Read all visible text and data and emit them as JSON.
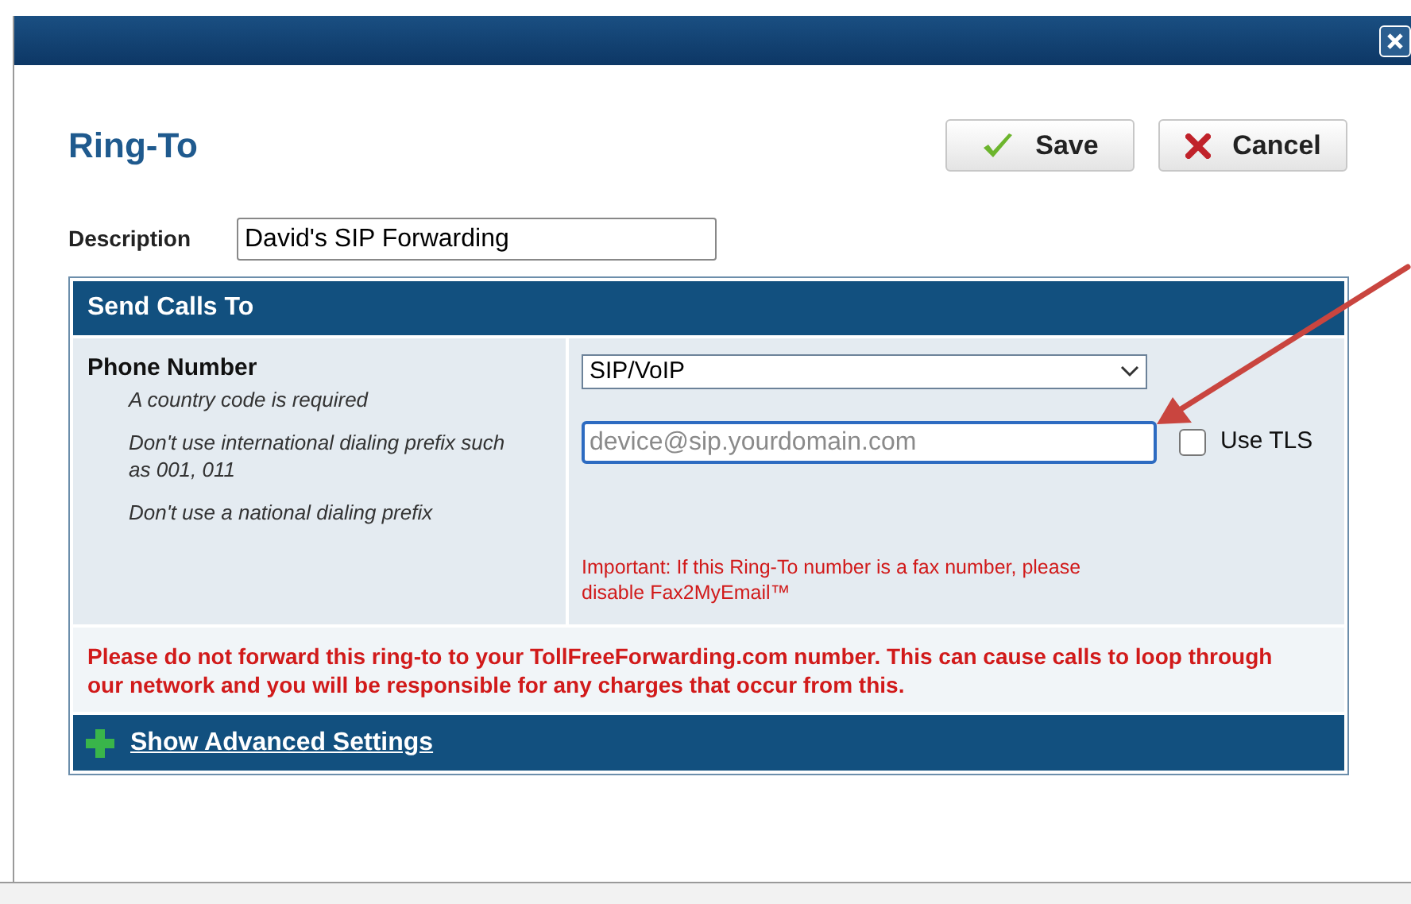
{
  "dialog": {
    "title": "Ring-To",
    "buttons": [
      {
        "kind": "save",
        "label": "Save"
      },
      {
        "kind": "cancel",
        "label": "Cancel"
      }
    ]
  },
  "description": {
    "label": "Description",
    "value": "David's SIP Forwarding"
  },
  "send_calls_to": {
    "heading": "Send Calls To",
    "phone_label": "Phone Number",
    "hints": [
      "A country code is required",
      "Don't use international dialing prefix such as 001, 011",
      "Don't use a national dialing prefix"
    ],
    "type_select": {
      "value": "SIP/VoIP"
    },
    "address_field": {
      "placeholder": "device@sip.yourdomain.com"
    },
    "use_tls": {
      "label": "Use TLS",
      "checked": false
    },
    "fax_note": "Important: If this Ring-To number is a fax number, please disable Fax2MyEmail™",
    "warning": "Please do not forward this ring-to to your TollFreeForwarding.com number. This can cause calls to loop through our network and you will be responsible for any charges that occur from this.",
    "advanced_link": "Show Advanced Settings"
  }
}
